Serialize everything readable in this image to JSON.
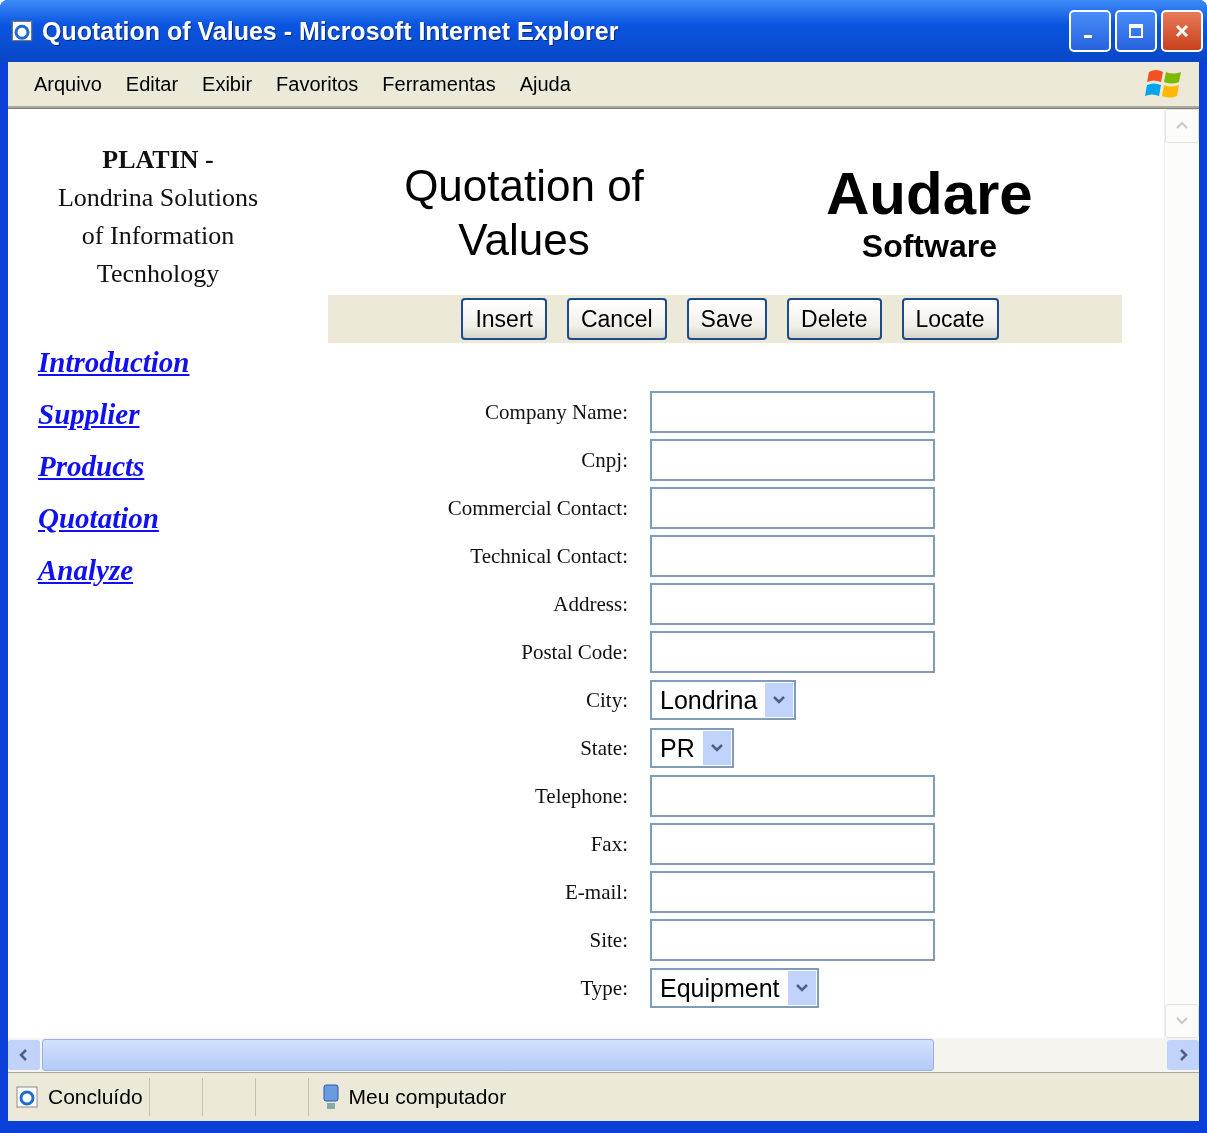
{
  "window": {
    "title": "Quotation of Values - Microsoft Internet Explorer"
  },
  "menu": [
    "Arquivo",
    "Editar",
    "Exibir",
    "Favoritos",
    "Ferramentas",
    "Ajuda"
  ],
  "company": {
    "name": "PLATIN -",
    "lines": [
      "Londrina Solutions",
      "of Information",
      "Tecnhology"
    ]
  },
  "nav_links": [
    "Introduction",
    "Supplier",
    "Products",
    "Quotation",
    "Analyze"
  ],
  "page_title": "Quotation of Values",
  "brand": {
    "name": "Audare",
    "tagline": "Software"
  },
  "buttons": [
    "Insert",
    "Cancel",
    "Save",
    "Delete",
    "Locate"
  ],
  "form": [
    {
      "label": "Company Name:",
      "kind": "text"
    },
    {
      "label": "Cnpj:",
      "kind": "text"
    },
    {
      "label": "Commercial Contact:",
      "kind": "text"
    },
    {
      "label": "Technical Contact:",
      "kind": "text"
    },
    {
      "label": "Address:",
      "kind": "text"
    },
    {
      "label": "Postal Code:",
      "kind": "text"
    },
    {
      "label": "City:",
      "kind": "select",
      "value": "Londrina"
    },
    {
      "label": "State:",
      "kind": "select",
      "value": "PR"
    },
    {
      "label": "Telephone:",
      "kind": "text"
    },
    {
      "label": "Fax:",
      "kind": "text"
    },
    {
      "label": "E-mail:",
      "kind": "text"
    },
    {
      "label": "Site:",
      "kind": "text"
    },
    {
      "label": "Type:",
      "kind": "select",
      "value": "Equipment"
    }
  ],
  "status_bar": {
    "status": "Concluído",
    "zone": "Meu computador"
  }
}
